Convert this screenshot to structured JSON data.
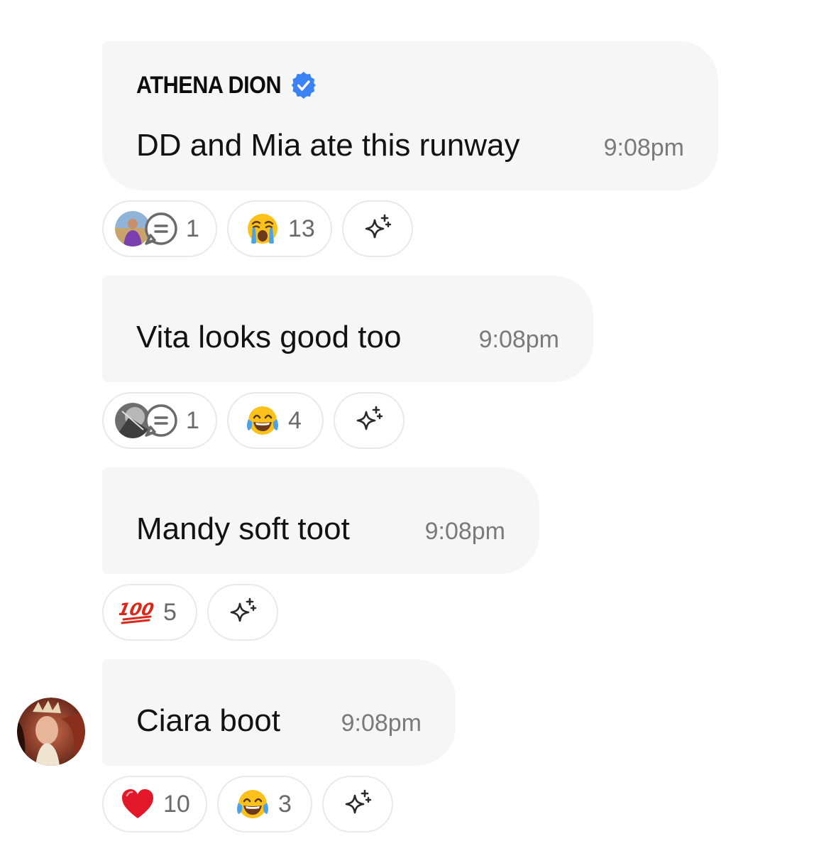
{
  "messages": [
    {
      "sender": "ATHENA DION",
      "text": "DD and Mia ate this runway",
      "time": "9:08pm",
      "thread_count": "1",
      "reactions": [
        {
          "emoji": "loudly-crying-face",
          "count": "13"
        }
      ]
    },
    {
      "text": "Vita looks good too",
      "time": "9:08pm",
      "thread_count": "1",
      "reactions": [
        {
          "emoji": "face-with-tears-of-joy",
          "count": "4"
        }
      ]
    },
    {
      "text": "Mandy soft toot",
      "time": "9:08pm",
      "reactions": [
        {
          "emoji": "hundred-points",
          "count": "5"
        }
      ]
    },
    {
      "text": "Ciara boot",
      "time": "9:08pm",
      "reactions": [
        {
          "emoji": "red-heart",
          "count": "10"
        },
        {
          "emoji": "face-with-tears-of-joy",
          "count": "3"
        }
      ]
    }
  ],
  "colors": {
    "bubble": "#f6f6f6",
    "verified": "#3b82f6",
    "timestamp": "#7a7a7a",
    "pill_border": "#e9e9e9"
  }
}
